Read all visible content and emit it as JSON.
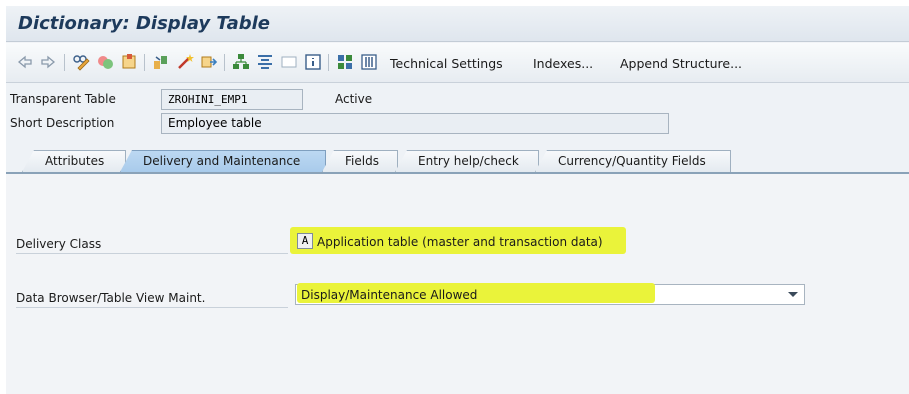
{
  "window": {
    "title": "Dictionary: Display Table"
  },
  "toolbar": {
    "icons": [
      "back-icon",
      "forward-icon",
      "display-change-icon",
      "activate-icon",
      "where-used-icon",
      "object-list-icon",
      "create-icon",
      "check-icon",
      "hierarchy-icon",
      "align-icon",
      "layout-icon",
      "info-icon",
      "grid-icon",
      "columns-icon"
    ],
    "technical_settings": "Technical Settings",
    "indexes": "Indexes...",
    "append_structure": "Append Structure..."
  },
  "header": {
    "table_type_label": "Transparent Table",
    "table_name": "ZROHINI_EMP1",
    "status": "Active",
    "short_desc_label": "Short Description",
    "short_desc": "Employee table"
  },
  "tabs": [
    {
      "label": "Attributes",
      "active": false
    },
    {
      "label": "Delivery and Maintenance",
      "active": true
    },
    {
      "label": "Fields",
      "active": false
    },
    {
      "label": "Entry help/check",
      "active": false
    },
    {
      "label": "Currency/Quantity Fields",
      "active": false
    }
  ],
  "delivery": {
    "class_label": "Delivery Class",
    "class_key": "A",
    "class_text": "Application table (master and transaction data)",
    "browser_label": "Data Browser/Table View Maint.",
    "browser_value": "Display/Maintenance Allowed"
  },
  "colors": {
    "highlight": "#eaf33a",
    "active_tab": "#a9cbeb",
    "title": "#1d3a5c"
  }
}
